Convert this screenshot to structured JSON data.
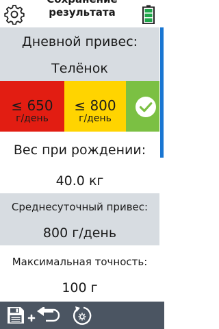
{
  "header": {
    "title_line1": "Сохранение",
    "title_line2": "результата",
    "settings_icon": "gear-icon",
    "battery_icon": "battery-full-icon",
    "battery_color": "#1fa64a"
  },
  "result": {
    "daily_gain_label": "Дневной привес:",
    "animal_type": "Телёнок",
    "ranges": [
      {
        "value": "≤ 650",
        "unit": "г/день",
        "color": "#e21d12"
      },
      {
        "value": "≤ 800",
        "unit": "г/день",
        "color": "#ffd400"
      },
      {
        "icon": "check-circle-icon",
        "color": "#7bc043"
      }
    ]
  },
  "details": {
    "birth_weight_label": "Вес при рождении:",
    "birth_weight_value": "40.0 кг",
    "avg_daily_gain_label": "Среднесуточный привес:",
    "avg_daily_gain_value": "800 г/день",
    "max_accuracy_label": "Максимальная точность:",
    "max_accuracy_value": "100 г"
  },
  "footer": {
    "buttons": [
      {
        "icon": "save-icon"
      },
      {
        "icon": "add-return-icon"
      },
      {
        "icon": "reset-settings-icon"
      }
    ],
    "background": "#4b5562"
  }
}
